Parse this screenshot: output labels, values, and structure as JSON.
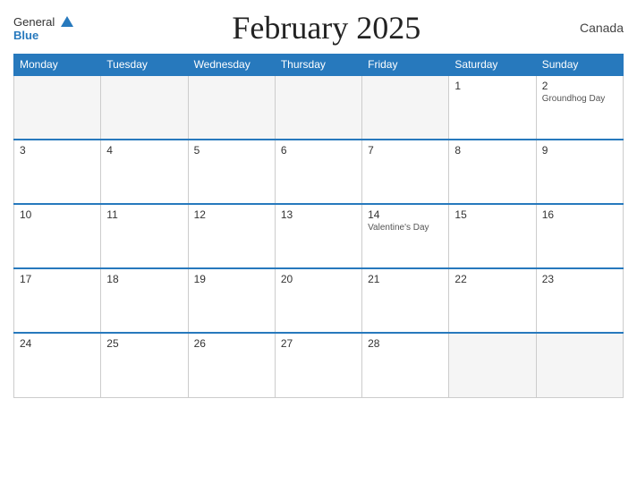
{
  "header": {
    "logo_general": "General",
    "logo_blue": "Blue",
    "title": "February 2025",
    "country": "Canada"
  },
  "calendar": {
    "weekdays": [
      "Monday",
      "Tuesday",
      "Wednesday",
      "Thursday",
      "Friday",
      "Saturday",
      "Sunday"
    ],
    "rows": [
      {
        "cells": [
          {
            "day": "",
            "empty": true
          },
          {
            "day": "",
            "empty": true
          },
          {
            "day": "",
            "empty": true
          },
          {
            "day": "",
            "empty": true
          },
          {
            "day": "",
            "empty": true
          },
          {
            "day": "1",
            "event": ""
          },
          {
            "day": "2",
            "event": "Groundhog Day"
          }
        ]
      },
      {
        "cells": [
          {
            "day": "3",
            "event": ""
          },
          {
            "day": "4",
            "event": ""
          },
          {
            "day": "5",
            "event": ""
          },
          {
            "day": "6",
            "event": ""
          },
          {
            "day": "7",
            "event": ""
          },
          {
            "day": "8",
            "event": ""
          },
          {
            "day": "9",
            "event": ""
          }
        ]
      },
      {
        "cells": [
          {
            "day": "10",
            "event": ""
          },
          {
            "day": "11",
            "event": ""
          },
          {
            "day": "12",
            "event": ""
          },
          {
            "day": "13",
            "event": ""
          },
          {
            "day": "14",
            "event": "Valentine's Day"
          },
          {
            "day": "15",
            "event": ""
          },
          {
            "day": "16",
            "event": ""
          }
        ]
      },
      {
        "cells": [
          {
            "day": "17",
            "event": ""
          },
          {
            "day": "18",
            "event": ""
          },
          {
            "day": "19",
            "event": ""
          },
          {
            "day": "20",
            "event": ""
          },
          {
            "day": "21",
            "event": ""
          },
          {
            "day": "22",
            "event": ""
          },
          {
            "day": "23",
            "event": ""
          }
        ]
      },
      {
        "cells": [
          {
            "day": "24",
            "event": ""
          },
          {
            "day": "25",
            "event": ""
          },
          {
            "day": "26",
            "event": ""
          },
          {
            "day": "27",
            "event": ""
          },
          {
            "day": "28",
            "event": ""
          },
          {
            "day": "",
            "empty": true
          },
          {
            "day": "",
            "empty": true
          }
        ]
      }
    ]
  }
}
